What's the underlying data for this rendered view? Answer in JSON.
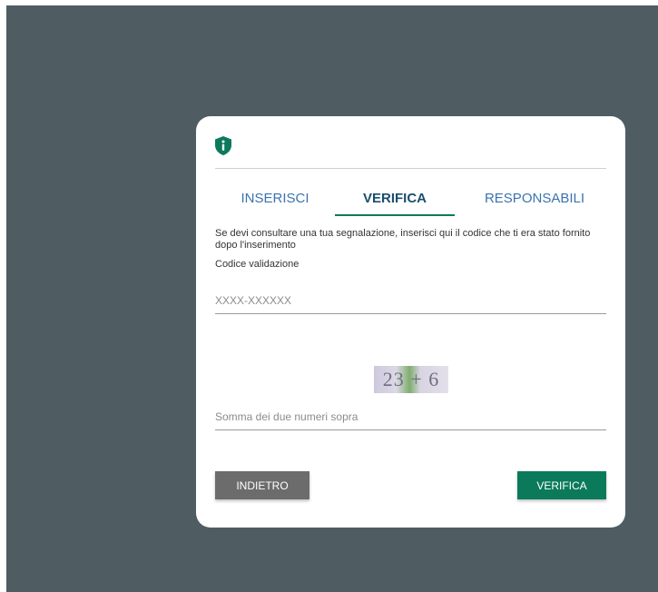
{
  "colors": {
    "backdrop": "#4f5d63",
    "accent": "#0b7a5a",
    "tab_text": "#3a73b0",
    "tab_active_text": "#1a4e6e",
    "back_button": "#6c6c6c"
  },
  "header": {
    "icon": "shield-info-icon"
  },
  "tabs": [
    {
      "label": "INSERISCI",
      "active": false
    },
    {
      "label": "VERIFICA",
      "active": true
    },
    {
      "label": "RESPONSABILI",
      "active": false
    }
  ],
  "form": {
    "intro": "Se devi consultare una tua segnalazione, inserisci qui il codice che ti era stato fornito dopo l'inserimento",
    "code_label": "Codice validazione",
    "code_value": "",
    "code_placeholder": "XXXX-XXXXXX",
    "captcha_text": "23 + 6",
    "sum_value": "",
    "sum_placeholder": "Somma dei due numeri sopra"
  },
  "buttons": {
    "back_label": "INDIETRO",
    "verify_label": "VERIFICA"
  }
}
